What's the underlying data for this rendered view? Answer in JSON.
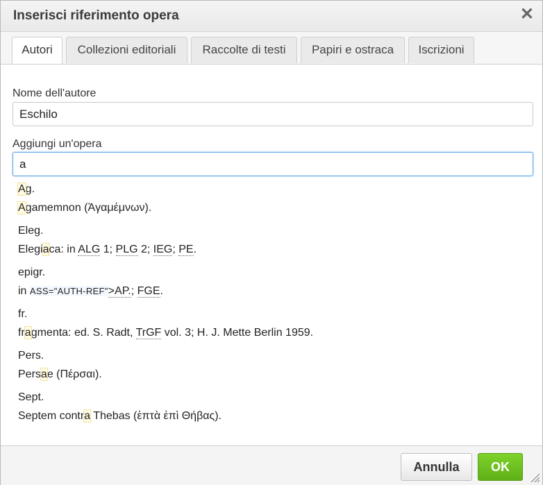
{
  "dialog": {
    "title": "Inserisci riferimento opera"
  },
  "tabs": [
    {
      "label": "Autori",
      "active": true
    },
    {
      "label": "Collezioni editoriali",
      "active": false
    },
    {
      "label": "Raccolte di testi",
      "active": false
    },
    {
      "label": "Papiri e ostraca",
      "active": false
    },
    {
      "label": "Iscrizioni",
      "active": false
    }
  ],
  "author": {
    "label": "Nome dell'autore",
    "value": "Eschilo"
  },
  "work": {
    "label": "Aggiungi un'opera",
    "value": "a"
  },
  "suggestions": [
    {
      "abbr_a": "A",
      "abbr_b": "g.",
      "full_a": "A",
      "full_b": "gamemnon (Ἀγαμέμνων)."
    },
    {
      "abbr": "Eleg.",
      "full_a": "Elegi",
      "full_hl": "a",
      "full_b": "ca: in ",
      "ref1": "ALG",
      "t1": " 1; ",
      "ref2": "PLG",
      "t2": " 2; ",
      "ref3": "IEG",
      "t3": "; ",
      "ref4": "PE",
      "t4": "."
    },
    {
      "abbr": "epigr.",
      "full_a": "in ",
      "code": "ASS=\"AUTH-REF\"",
      "code_b": ">AP.",
      "full_b": "; ",
      "ref1": "FGE",
      "t1": "."
    },
    {
      "abbr": "fr.",
      "full_a": "fr",
      "full_hl": "a",
      "full_b": "gmenta: ed. S. Radt, ",
      "ref1": "TrGF",
      "t1": " vol. 3; H. J. Mette Berlin 1959."
    },
    {
      "abbr": "Pers.",
      "full_a": "Pers",
      "full_hl": "a",
      "full_b": "e (Πέρσαι)."
    },
    {
      "abbr": "Sept.",
      "full_a": "Septem contr",
      "full_hl": "a",
      "full_b": " Thebas (ἑπτὰ ἐπὶ Θήβας)."
    }
  ],
  "footer": {
    "cancel_label": "Annulla",
    "ok_label": "OK"
  },
  "colors": {
    "ok_green": "#6cc01f",
    "focus_blue": "#5ba6e6",
    "highlight": "#f2e3a0"
  }
}
